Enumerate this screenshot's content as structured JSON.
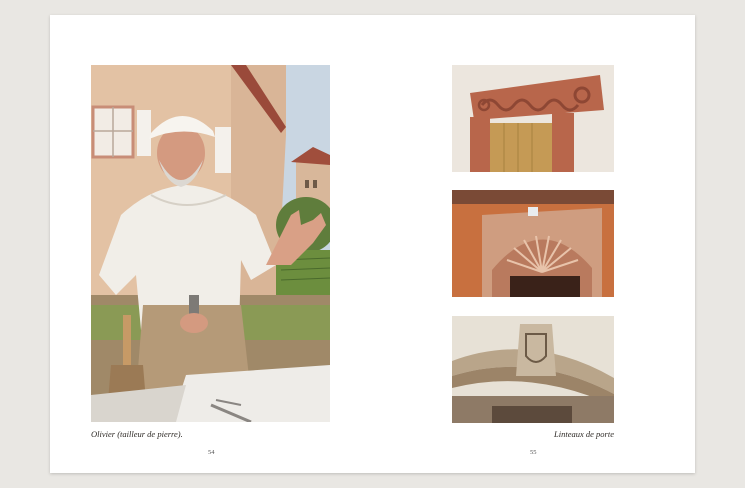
{
  "left_page": {
    "caption": "Olivier (tailleur de pierre).",
    "page_number": "54",
    "photo_icon": "stonemason-portrait-photo"
  },
  "right_page": {
    "caption": "Linteaux de porte",
    "page_number": "55",
    "photos": [
      {
        "icon": "carved-lintel-spiral-photo"
      },
      {
        "icon": "carved-lintel-shell-photo"
      },
      {
        "icon": "carved-lintel-crest-photo"
      }
    ]
  },
  "colors": {
    "background": "#e9e7e3",
    "page": "#ffffff",
    "sandstone": "#b8664b",
    "plaster": "#e8cdb3"
  }
}
